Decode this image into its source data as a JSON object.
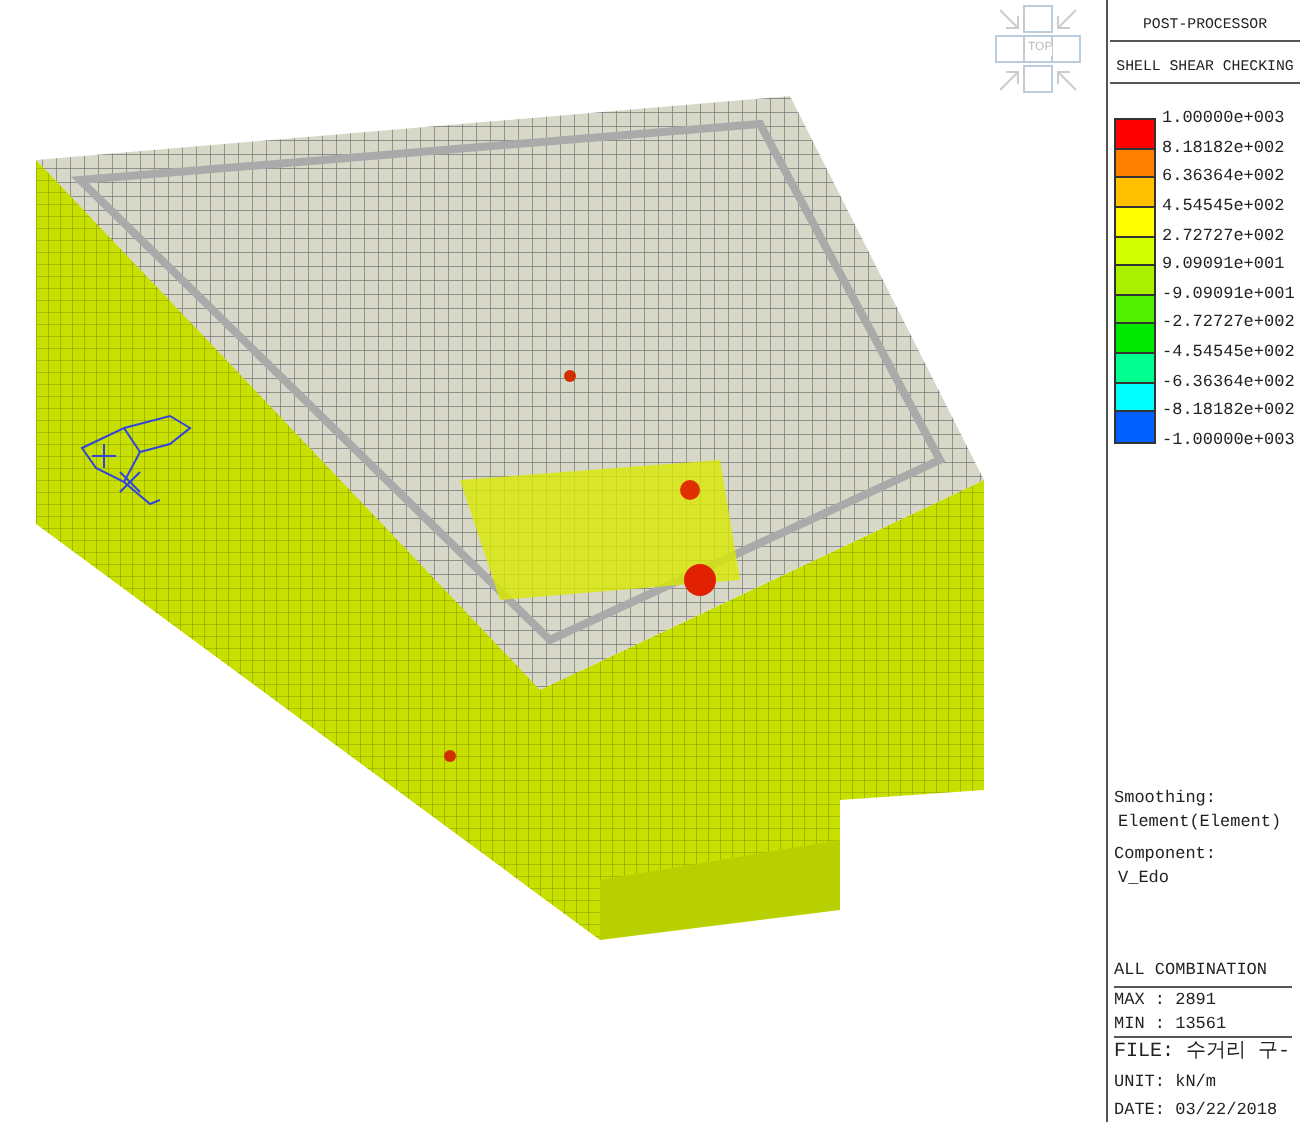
{
  "view_cube": {
    "face_label": "TOP"
  },
  "legend": {
    "header": "POST-PROCESSOR",
    "title": "SHELL SHEAR CHECKING",
    "bands": [
      {
        "color": "#ff0000"
      },
      {
        "color": "#ff8000"
      },
      {
        "color": "#ffc000"
      },
      {
        "color": "#ffff00"
      },
      {
        "color": "#d4ff00"
      },
      {
        "color": "#aaf000"
      },
      {
        "color": "#50f000"
      },
      {
        "color": "#00e800"
      },
      {
        "color": "#00ff90"
      },
      {
        "color": "#00ffff"
      },
      {
        "color": "#0060ff"
      }
    ],
    "ticks": [
      "1.00000e+003",
      "8.18182e+002",
      "6.36364e+002",
      "4.54545e+002",
      "2.72727e+002",
      "9.09091e+001",
      "-9.09091e+001",
      "-2.72727e+002",
      "-4.54545e+002",
      "-6.36364e+002",
      "-8.18182e+002",
      "-1.00000e+003"
    ]
  },
  "settings": [
    {
      "label": "Smoothing:",
      "value": "Element(Element)"
    },
    {
      "label": "Component:",
      "value": "V_Edo"
    }
  ],
  "combination": "ALL COMBINATION",
  "extremes": [
    "MAX : 2891",
    "MIN : 13561"
  ],
  "file_info": [
    "FILE: 수거리 구-",
    "UNIT: kN/m",
    "DATE: 03/22/2018"
  ]
}
